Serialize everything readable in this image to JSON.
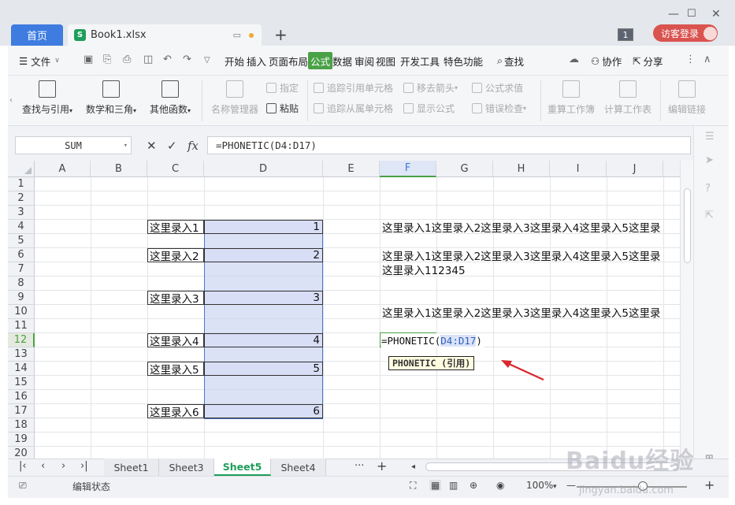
{
  "titlebar": {
    "home_tab": "首页",
    "file_tab": "Book1.xlsx",
    "badge": "1",
    "guest_login": "访客登录"
  },
  "menu": {
    "file": "文件",
    "items": [
      "开始",
      "插入",
      "页面布局",
      "公式",
      "数据",
      "审阅",
      "视图",
      "开发工具",
      "特色功能"
    ],
    "active": "公式",
    "search": "查找",
    "collab": "协作",
    "share": "分享"
  },
  "ribbon": {
    "lookup": "查找与引用",
    "math": "数学和三角",
    "other_funcs": "其他函数",
    "name_manager": "名称管理器",
    "assign": "指定",
    "paste": "粘贴",
    "trace_precedents": "追踪引用单元格",
    "trace_dependents": "追踪从属单元格",
    "remove_arrows": "移去箭头",
    "show_formulas": "显示公式",
    "evaluate": "公式求值",
    "error_check": "错误检查",
    "recalc_book": "重算工作簿",
    "calc_sheet": "计算工作表",
    "edit_links": "编辑链接"
  },
  "formula_bar": {
    "name_box": "SUM",
    "formula": "=PHONETIC(D4:D17)"
  },
  "grid": {
    "columns": [
      "A",
      "B",
      "C",
      "D",
      "E",
      "F",
      "G",
      "H",
      "I",
      "J"
    ],
    "rows": [
      "1",
      "2",
      "3",
      "4",
      "5",
      "6",
      "7",
      "8",
      "9",
      "10",
      "11",
      "12",
      "13",
      "14",
      "15",
      "16",
      "17",
      "18",
      "19",
      "20"
    ],
    "c_cells": [
      {
        "row": 4,
        "text": "这里录入1"
      },
      {
        "row": 6,
        "text": "这里录入2"
      },
      {
        "row": 9,
        "text": "这里录入3"
      },
      {
        "row": 12,
        "text": "这里录入4"
      },
      {
        "row": 14,
        "text": "这里录入5"
      },
      {
        "row": 17,
        "text": "这里录入6"
      }
    ],
    "d_cells": [
      {
        "row": 4,
        "text": "1"
      },
      {
        "row": 6,
        "text": "2"
      },
      {
        "row": 9,
        "text": "3"
      },
      {
        "row": 12,
        "text": "4"
      },
      {
        "row": 14,
        "text": "5"
      },
      {
        "row": 17,
        "text": "6"
      }
    ],
    "f_cells": [
      {
        "row": 4,
        "text": "这里录入1这里录入2这里录入3这里录入4这里录入5这里录"
      },
      {
        "row": 6,
        "text": "这里录入1这里录入2这里录入3这里录入4这里录入5这里录"
      },
      {
        "row": 7,
        "text": "这里录入112345"
      },
      {
        "row": 10,
        "text": "这里录入1这里录入2这里录入3这里录入4这里录入5这里录"
      }
    ],
    "editing_formula_prefix": "=PHONETIC(",
    "editing_formula_ref": "D4:D17",
    "editing_formula_suffix": ")",
    "tooltip": "PHONETIC (引用)"
  },
  "sheets": {
    "tabs": [
      "Sheet1",
      "Sheet3",
      "Sheet5",
      "Sheet4"
    ],
    "active": "Sheet5",
    "more": "···",
    "add": "+"
  },
  "status": {
    "mode": "编辑状态",
    "zoom": "100%"
  },
  "watermark": {
    "main": "Baidu经验",
    "sub": "jingyan.baidu.com"
  }
}
